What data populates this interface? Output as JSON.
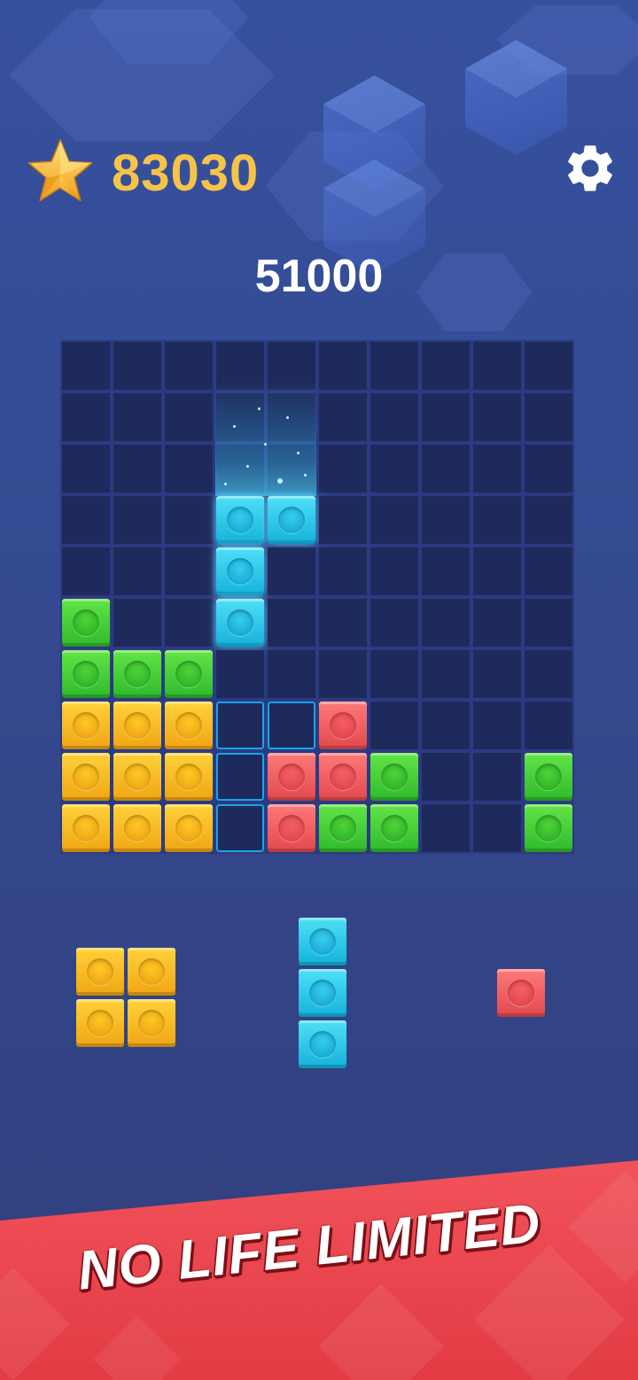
{
  "header": {
    "coins": "83030",
    "star_icon": "star-icon",
    "settings_icon": "gear-icon"
  },
  "score": "51000",
  "board": {
    "size": 10,
    "cells": [
      [
        0,
        0,
        0,
        0,
        0,
        0,
        0,
        0,
        0,
        0
      ],
      [
        0,
        0,
        0,
        0,
        0,
        0,
        0,
        0,
        0,
        0
      ],
      [
        0,
        0,
        0,
        0,
        0,
        0,
        0,
        0,
        0,
        0
      ],
      [
        0,
        0,
        0,
        "cyan",
        "cyan",
        0,
        0,
        0,
        0,
        0
      ],
      [
        0,
        0,
        0,
        "cyan",
        0,
        0,
        0,
        0,
        0,
        0
      ],
      [
        "green",
        0,
        0,
        "cyan",
        0,
        0,
        0,
        0,
        0,
        0
      ],
      [
        "green",
        "green",
        "green",
        0,
        0,
        0,
        0,
        0,
        0,
        0
      ],
      [
        "yellow",
        "yellow",
        "yellow",
        "ghost",
        "ghost",
        "red",
        0,
        0,
        0,
        0
      ],
      [
        "yellow",
        "yellow",
        "yellow",
        "ghost",
        "red",
        "red",
        "green",
        0,
        0,
        "green"
      ],
      [
        "yellow",
        "yellow",
        "yellow",
        "ghost",
        "red",
        "green",
        "green",
        0,
        0,
        "green"
      ]
    ]
  },
  "tray": [
    {
      "name": "square-yellow",
      "color": "yellow",
      "shape": [
        [
          1,
          1
        ],
        [
          1,
          1
        ]
      ]
    },
    {
      "name": "vertical-cyan",
      "color": "cyan",
      "shape": [
        [
          1
        ],
        [
          1
        ],
        [
          1
        ]
      ]
    },
    {
      "name": "single-red",
      "color": "red",
      "shape": [
        [
          1
        ]
      ]
    }
  ],
  "colors": {
    "green": "#3fcf35",
    "yellow": "#f8bb22",
    "red": "#ee5a5e",
    "cyan": "#2cc7ea",
    "empty": "#1f2a5c",
    "coin_text": "#f6c34a"
  },
  "banner": {
    "text": "NO LIFE LIMITED"
  }
}
